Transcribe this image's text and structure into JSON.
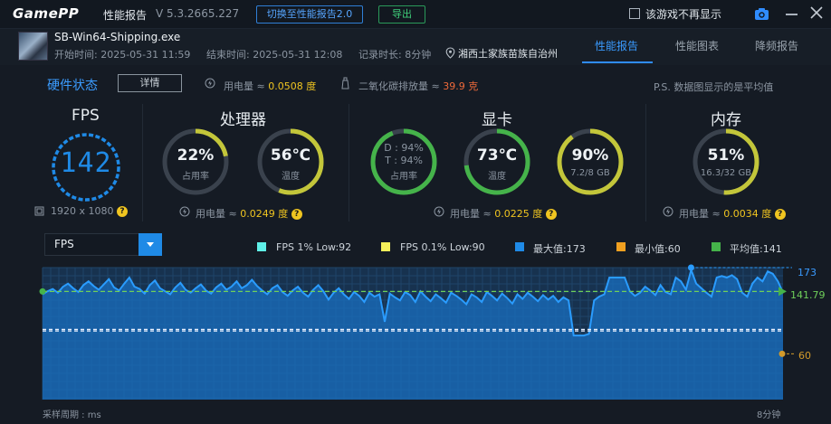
{
  "titlebar": {
    "logo": "GamePP",
    "title": "性能报告",
    "version": "V 5.3.2665.227",
    "switch_btn": "切换至性能报告2.0",
    "export_btn": "导出",
    "no_show_label": "该游戏不再显示"
  },
  "info": {
    "exe": "SB-Win64-Shipping.exe",
    "start": "开始时间: 2025-05-31 11:59",
    "end": "结束时间: 2025-05-31 12:08",
    "duration": "记录时长: 8分钟",
    "location": "湘西土家族苗族自治州"
  },
  "tabs": [
    {
      "label": "性能报告"
    },
    {
      "label": "性能图表"
    },
    {
      "label": "降频报告"
    }
  ],
  "hw": {
    "title": "硬件状态",
    "detail_btn": "详情",
    "power_prefix": "用电量 ≈ ",
    "power_total": "0.0508 度",
    "co2_prefix": "二氧化碳排放量 ≈ ",
    "co2": "39.9 克",
    "note": "P.S. 数据图显示的是平均值"
  },
  "fps": {
    "title": "FPS",
    "value": "142",
    "resolution": "1920 x 1080"
  },
  "cpu": {
    "title": "处理器",
    "usage_value": "22%",
    "usage_label": "占用率",
    "usage_fraction": 0.22,
    "temp_value": "56℃",
    "temp_label": "温度",
    "temp_fraction": 0.56,
    "power": "0.0249 度"
  },
  "gpu": {
    "title": "显卡",
    "d_line": "D : 94%",
    "t_line": "T : 94%",
    "usage_label": "占用率",
    "usage_fraction": 0.94,
    "temp_value": "73℃",
    "temp_label": "温度",
    "temp_fraction": 0.73,
    "vram_value": "90%",
    "vram_sub": "7.2/8 GB",
    "vram_fraction": 0.9,
    "power": "0.0225 度"
  },
  "mem": {
    "title": "内存",
    "usage_value": "51%",
    "usage_sub": "16.3/32 GB",
    "usage_fraction": 0.51,
    "power": "0.0034 度"
  },
  "chart": {
    "select_value": "FPS",
    "legend": [
      {
        "label": "FPS 1% Low:92",
        "color": "#5ff0e8"
      },
      {
        "label": "FPS 0.1% Low:90",
        "color": "#f4f05a"
      },
      {
        "label": "最大值:173",
        "color": "#1f8ae6"
      },
      {
        "label": "最小值:60",
        "color": "#f0a020"
      },
      {
        "label": "平均值:141",
        "color": "#45b34a"
      }
    ],
    "x_start_label": "采样周期 : ms",
    "x_end_label": "8分钟",
    "max_label": "173",
    "avg_label": "141.79",
    "min_label": "60"
  },
  "chart_data": {
    "type": "area",
    "series": [
      {
        "name": "FPS",
        "values": [
          138,
          142,
          145,
          140,
          148,
          152,
          146,
          141,
          150,
          155,
          149,
          144,
          151,
          158,
          147,
          143,
          152,
          160,
          148,
          145,
          139,
          150,
          156,
          146,
          142,
          138,
          147,
          153,
          144,
          140,
          146,
          151,
          143,
          139,
          147,
          152,
          144,
          148,
          155,
          146,
          150,
          157,
          149,
          143,
          138,
          146,
          150,
          141,
          136,
          143,
          148,
          140,
          135,
          144,
          150,
          142,
          131,
          140,
          146,
          138,
          132,
          141,
          136,
          128,
          140,
          135,
          138,
          102,
          139,
          134,
          130,
          141,
          137,
          128,
          142,
          135,
          129,
          138,
          133,
          127,
          140,
          136,
          131,
          125,
          138,
          134,
          128,
          141,
          136,
          130,
          139,
          133,
          126,
          138,
          132,
          140,
          135,
          129,
          137,
          131,
          136,
          128,
          134,
          130,
          84,
          84,
          84,
          86,
          130,
          135,
          138,
          160,
          160,
          160,
          160,
          142,
          136,
          140,
          148,
          143,
          137,
          150,
          141,
          138,
          160,
          155,
          144,
          170,
          152,
          146,
          140,
          135,
          160,
          162,
          160,
          163,
          158,
          140,
          135,
          152,
          160,
          155,
          168,
          165,
          155,
          140
        ]
      }
    ],
    "ylim": [
      0,
      173
    ],
    "max": 173,
    "min": 60,
    "avg": 141.79,
    "low1": 92,
    "low01": 90
  }
}
